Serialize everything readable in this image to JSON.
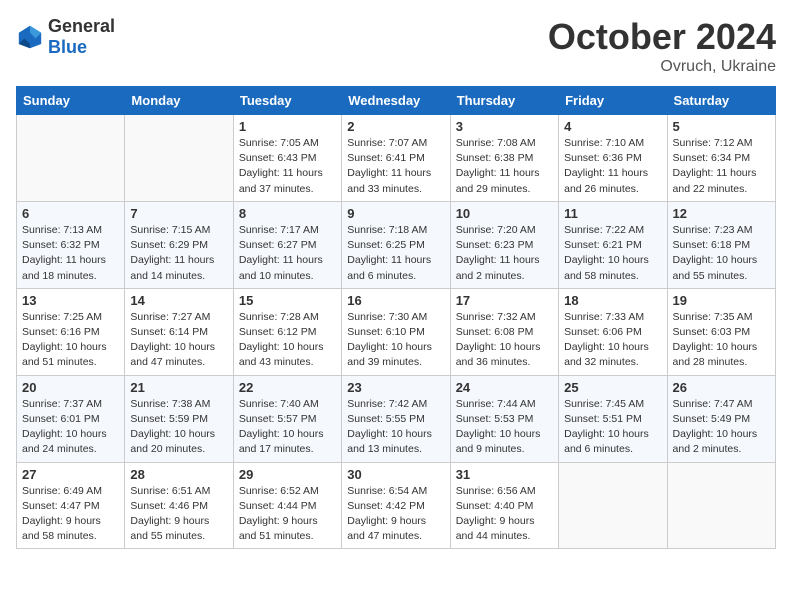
{
  "header": {
    "logo_general": "General",
    "logo_blue": "Blue",
    "month_year": "October 2024",
    "location": "Ovruch, Ukraine"
  },
  "days_of_week": [
    "Sunday",
    "Monday",
    "Tuesday",
    "Wednesday",
    "Thursday",
    "Friday",
    "Saturday"
  ],
  "weeks": [
    [
      {
        "day": "",
        "info": ""
      },
      {
        "day": "",
        "info": ""
      },
      {
        "day": "1",
        "info": "Sunrise: 7:05 AM\nSunset: 6:43 PM\nDaylight: 11 hours\nand 37 minutes."
      },
      {
        "day": "2",
        "info": "Sunrise: 7:07 AM\nSunset: 6:41 PM\nDaylight: 11 hours\nand 33 minutes."
      },
      {
        "day": "3",
        "info": "Sunrise: 7:08 AM\nSunset: 6:38 PM\nDaylight: 11 hours\nand 29 minutes."
      },
      {
        "day": "4",
        "info": "Sunrise: 7:10 AM\nSunset: 6:36 PM\nDaylight: 11 hours\nand 26 minutes."
      },
      {
        "day": "5",
        "info": "Sunrise: 7:12 AM\nSunset: 6:34 PM\nDaylight: 11 hours\nand 22 minutes."
      }
    ],
    [
      {
        "day": "6",
        "info": "Sunrise: 7:13 AM\nSunset: 6:32 PM\nDaylight: 11 hours\nand 18 minutes."
      },
      {
        "day": "7",
        "info": "Sunrise: 7:15 AM\nSunset: 6:29 PM\nDaylight: 11 hours\nand 14 minutes."
      },
      {
        "day": "8",
        "info": "Sunrise: 7:17 AM\nSunset: 6:27 PM\nDaylight: 11 hours\nand 10 minutes."
      },
      {
        "day": "9",
        "info": "Sunrise: 7:18 AM\nSunset: 6:25 PM\nDaylight: 11 hours\nand 6 minutes."
      },
      {
        "day": "10",
        "info": "Sunrise: 7:20 AM\nSunset: 6:23 PM\nDaylight: 11 hours\nand 2 minutes."
      },
      {
        "day": "11",
        "info": "Sunrise: 7:22 AM\nSunset: 6:21 PM\nDaylight: 10 hours\nand 58 minutes."
      },
      {
        "day": "12",
        "info": "Sunrise: 7:23 AM\nSunset: 6:18 PM\nDaylight: 10 hours\nand 55 minutes."
      }
    ],
    [
      {
        "day": "13",
        "info": "Sunrise: 7:25 AM\nSunset: 6:16 PM\nDaylight: 10 hours\nand 51 minutes."
      },
      {
        "day": "14",
        "info": "Sunrise: 7:27 AM\nSunset: 6:14 PM\nDaylight: 10 hours\nand 47 minutes."
      },
      {
        "day": "15",
        "info": "Sunrise: 7:28 AM\nSunset: 6:12 PM\nDaylight: 10 hours\nand 43 minutes."
      },
      {
        "day": "16",
        "info": "Sunrise: 7:30 AM\nSunset: 6:10 PM\nDaylight: 10 hours\nand 39 minutes."
      },
      {
        "day": "17",
        "info": "Sunrise: 7:32 AM\nSunset: 6:08 PM\nDaylight: 10 hours\nand 36 minutes."
      },
      {
        "day": "18",
        "info": "Sunrise: 7:33 AM\nSunset: 6:06 PM\nDaylight: 10 hours\nand 32 minutes."
      },
      {
        "day": "19",
        "info": "Sunrise: 7:35 AM\nSunset: 6:03 PM\nDaylight: 10 hours\nand 28 minutes."
      }
    ],
    [
      {
        "day": "20",
        "info": "Sunrise: 7:37 AM\nSunset: 6:01 PM\nDaylight: 10 hours\nand 24 minutes."
      },
      {
        "day": "21",
        "info": "Sunrise: 7:38 AM\nSunset: 5:59 PM\nDaylight: 10 hours\nand 20 minutes."
      },
      {
        "day": "22",
        "info": "Sunrise: 7:40 AM\nSunset: 5:57 PM\nDaylight: 10 hours\nand 17 minutes."
      },
      {
        "day": "23",
        "info": "Sunrise: 7:42 AM\nSunset: 5:55 PM\nDaylight: 10 hours\nand 13 minutes."
      },
      {
        "day": "24",
        "info": "Sunrise: 7:44 AM\nSunset: 5:53 PM\nDaylight: 10 hours\nand 9 minutes."
      },
      {
        "day": "25",
        "info": "Sunrise: 7:45 AM\nSunset: 5:51 PM\nDaylight: 10 hours\nand 6 minutes."
      },
      {
        "day": "26",
        "info": "Sunrise: 7:47 AM\nSunset: 5:49 PM\nDaylight: 10 hours\nand 2 minutes."
      }
    ],
    [
      {
        "day": "27",
        "info": "Sunrise: 6:49 AM\nSunset: 4:47 PM\nDaylight: 9 hours\nand 58 minutes."
      },
      {
        "day": "28",
        "info": "Sunrise: 6:51 AM\nSunset: 4:46 PM\nDaylight: 9 hours\nand 55 minutes."
      },
      {
        "day": "29",
        "info": "Sunrise: 6:52 AM\nSunset: 4:44 PM\nDaylight: 9 hours\nand 51 minutes."
      },
      {
        "day": "30",
        "info": "Sunrise: 6:54 AM\nSunset: 4:42 PM\nDaylight: 9 hours\nand 47 minutes."
      },
      {
        "day": "31",
        "info": "Sunrise: 6:56 AM\nSunset: 4:40 PM\nDaylight: 9 hours\nand 44 minutes."
      },
      {
        "day": "",
        "info": ""
      },
      {
        "day": "",
        "info": ""
      }
    ]
  ]
}
